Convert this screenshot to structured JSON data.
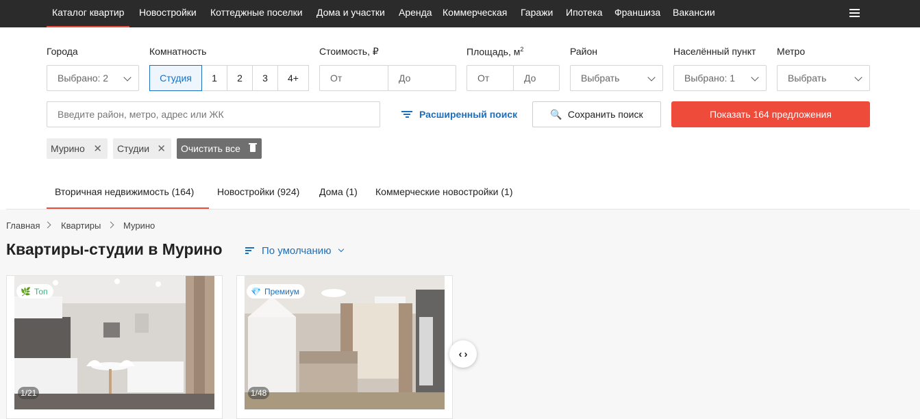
{
  "nav": {
    "items": [
      "Каталог квартир",
      "Новостройки",
      "Коттеджные поселки",
      "Дома и участки",
      "Аренда",
      "Коммерческая",
      "Гаражи",
      "Ипотека",
      "Франшиза",
      "Вакансии"
    ],
    "active": "Каталог квартир",
    "menu_icon": "burger-menu-icon"
  },
  "filters": {
    "city": {
      "label": "Города",
      "value": "Выбрано: 2"
    },
    "rooms": {
      "label": "Комнатность",
      "options": [
        "Студия",
        "1",
        "2",
        "3",
        "4+"
      ],
      "selected": "Студия"
    },
    "price": {
      "label": "Стоимость, ₽",
      "from": "От",
      "to": "До"
    },
    "area": {
      "label": "Площадь, м",
      "unit_sup": "2",
      "from": "От",
      "to": "До"
    },
    "district": {
      "label": "Район",
      "value": "Выбрать"
    },
    "locality": {
      "label": "Населённый пункт",
      "value": "Выбрано: 1"
    },
    "metro": {
      "label": "Метро",
      "value": "Выбрать"
    }
  },
  "search": {
    "placeholder": "Введите район, метро, адрес или ЖК",
    "advanced": "Расширенный поиск",
    "save": "Сохранить поиск",
    "show": "Показать 164 предложения"
  },
  "chips": {
    "items": [
      "Мурино",
      "Студии"
    ],
    "clear": "Очистить все"
  },
  "tabs": [
    "Вторичная недвижимость (164)",
    "Новостройки (924)",
    "Дома (1)",
    "Коммерческие новостройки (1)"
  ],
  "breadcrumb": [
    "Главная",
    "Квартиры",
    "Мурино"
  ],
  "page_title": "Квартиры-студии в Мурино",
  "sort_label": "По умолчанию",
  "cards": [
    {
      "badge": "Топ",
      "badge_color": "#36b37e",
      "counter": "1/21"
    },
    {
      "badge": "Премиум",
      "badge_color": "#1b6fbd",
      "counter": "1/48"
    }
  ],
  "colors": {
    "accent": "#ee4b3b",
    "link": "#1b6fbd",
    "nav_bg": "#2b2b2b"
  }
}
